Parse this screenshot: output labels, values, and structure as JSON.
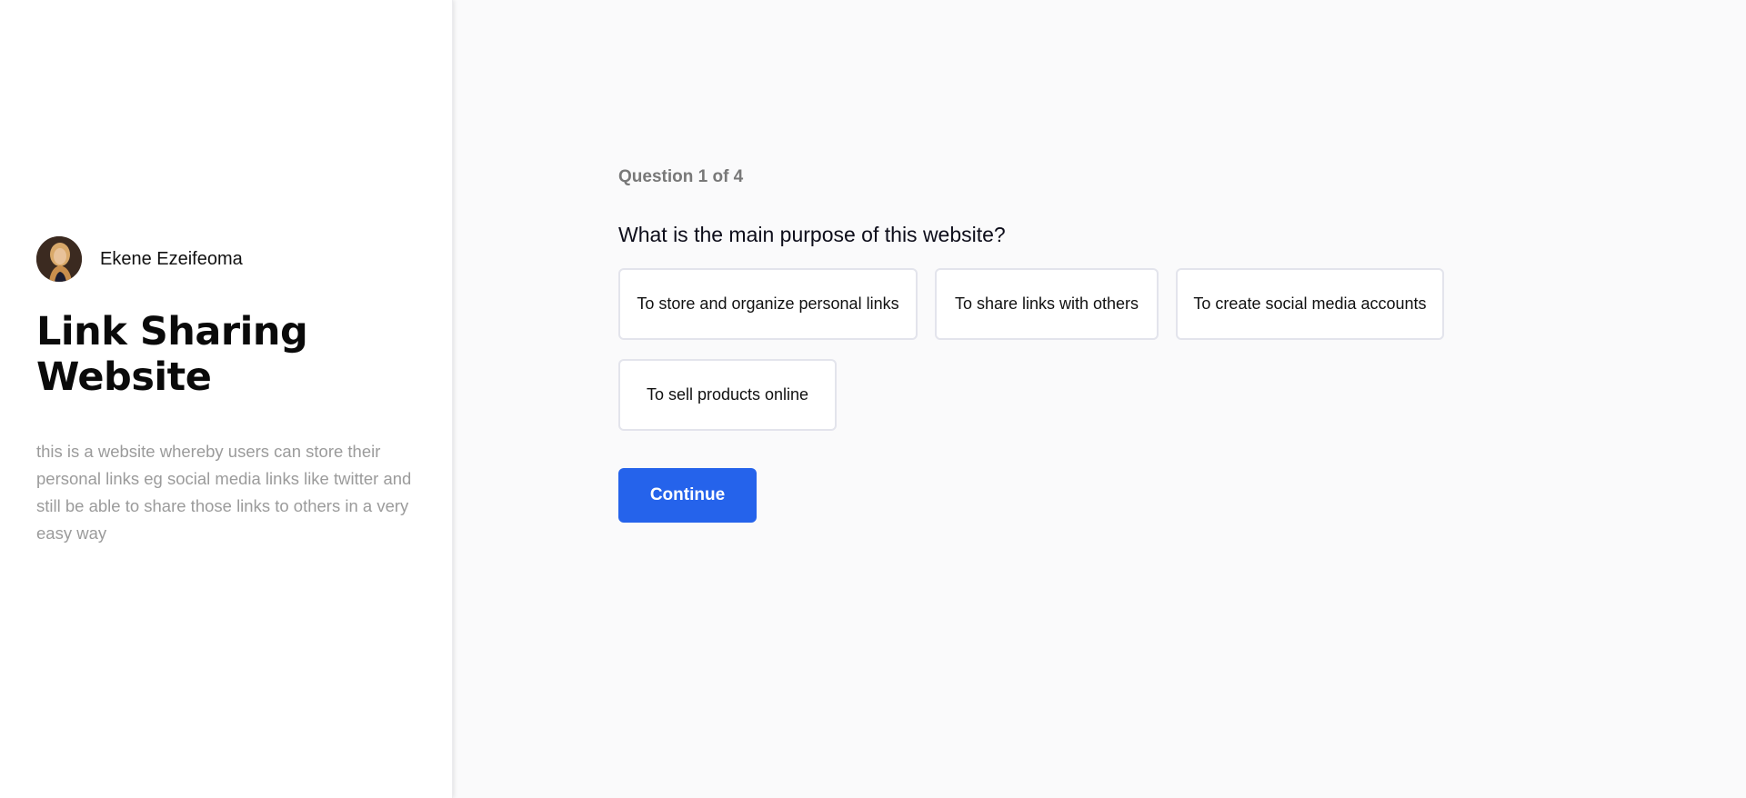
{
  "sidebar": {
    "author": {
      "name": "Ekene Ezeifeoma",
      "avatar_icon": "user-avatar-photo"
    },
    "title": "Link Sharing Website",
    "description": "this is a website whereby users can store their personal links eg social media links like twitter and still be able to share those links to others in a very easy way"
  },
  "quiz": {
    "progress": "Question 1 of 4",
    "question": "What is the main purpose of this website?",
    "options": [
      "To store and organize personal links",
      "To share links with others",
      "To create social media accounts",
      "To sell products online"
    ],
    "continue_label": "Continue"
  },
  "colors": {
    "accent": "#2563eb",
    "sidebar_bg": "#ffffff",
    "main_bg": "#fafafb",
    "muted_text": "#9b9b9b",
    "option_border": "#e3e4ec"
  }
}
